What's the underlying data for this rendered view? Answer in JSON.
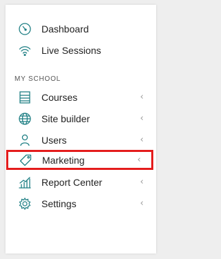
{
  "menu": {
    "items_top": [
      {
        "label": "Dashboard",
        "icon": "dashboard-gauge-icon"
      },
      {
        "label": "Live Sessions",
        "icon": "wifi-icon"
      }
    ],
    "section_title": "MY SCHOOL",
    "items_school": [
      {
        "label": "Courses",
        "icon": "courses-document-icon",
        "chevron": "‹"
      },
      {
        "label": "Site builder",
        "icon": "globe-icon",
        "chevron": "‹"
      },
      {
        "label": "Users",
        "icon": "user-icon",
        "chevron": "‹"
      },
      {
        "label": "Marketing",
        "icon": "tag-icon",
        "chevron": "‹",
        "highlighted": true
      },
      {
        "label": "Report Center",
        "icon": "chart-icon",
        "chevron": "‹"
      },
      {
        "label": "Settings",
        "icon": "gear-icon",
        "chevron": "‹"
      }
    ]
  },
  "colors": {
    "icon_teal": "#1f7f84",
    "highlight_border": "#e41c1c",
    "chevron": "#9a9a9a",
    "text": "#222222"
  }
}
